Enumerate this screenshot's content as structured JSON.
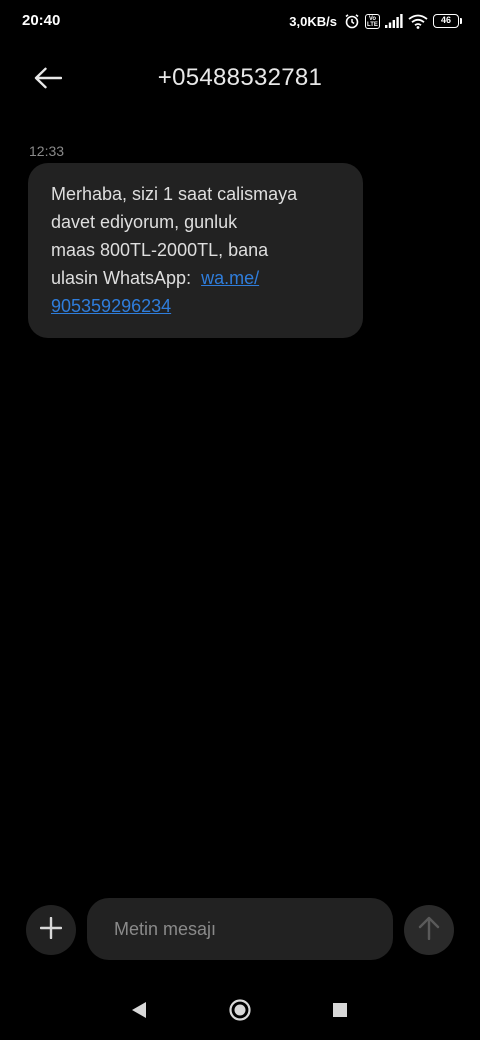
{
  "status_bar": {
    "time": "20:40",
    "net_speed": "3,0KB/s",
    "icons": [
      "alarm-icon",
      "volte-icon",
      "signal-icon",
      "wifi-icon",
      "battery-icon"
    ],
    "volte_label": "Vo\nLTE",
    "battery_level": "46"
  },
  "header": {
    "back_icon": "arrow-left-icon",
    "title": "+05488532781"
  },
  "conversation": {
    "messages": [
      {
        "time": "12:33",
        "text": "Merhaba, sizi 1 saat calismaya\ndavet ediyorum, gunluk\nmaas 800TL-2000TL, bana\nulasin WhatsApp:  ",
        "link": "wa.me/\n905359296234"
      }
    ]
  },
  "composer": {
    "add_icon": "plus-icon",
    "placeholder": "Metin mesajı",
    "value": "",
    "send_icon": "arrow-up-icon"
  },
  "nav_bar": {
    "icons": [
      "back-triangle-icon",
      "home-circle-icon",
      "recents-square-icon"
    ]
  },
  "colors": {
    "background": "#000000",
    "bubble": "#222222",
    "link": "#2f7ddb",
    "timestamp": "#8a8a8a"
  }
}
